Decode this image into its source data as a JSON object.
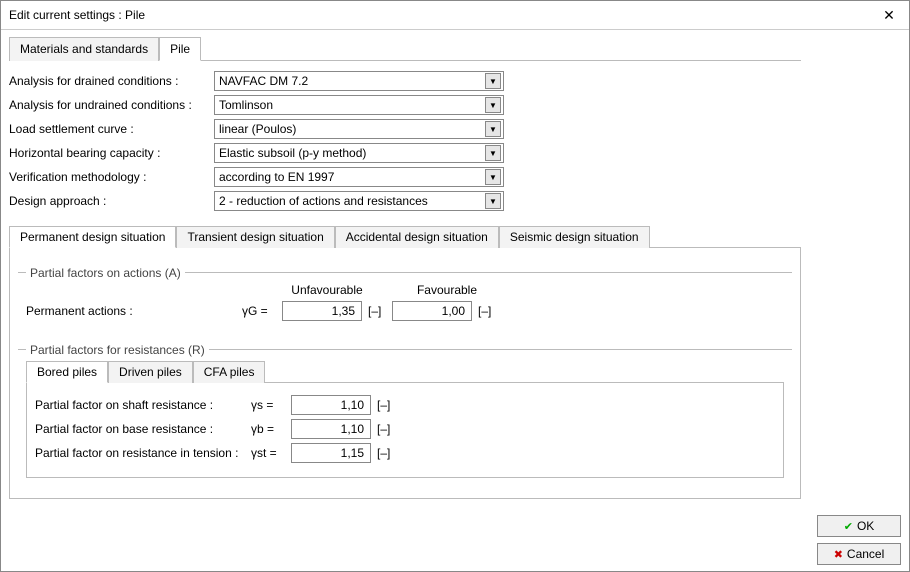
{
  "window": {
    "title": "Edit current settings : Pile"
  },
  "top_tabs": {
    "materials": "Materials and standards",
    "pile": "Pile"
  },
  "settings": {
    "analysis_drained": {
      "label": "Analysis for drained conditions :",
      "value": "NAVFAC DM 7.2"
    },
    "analysis_undrained": {
      "label": "Analysis for undrained conditions :",
      "value": "Tomlinson"
    },
    "load_settlement": {
      "label": "Load settlement curve :",
      "value": "linear (Poulos)"
    },
    "horiz_capacity": {
      "label": "Horizontal bearing capacity :",
      "value": "Elastic subsoil (p-y method)"
    },
    "verification": {
      "label": "Verification methodology :",
      "value": "according to EN 1997"
    },
    "design_approach": {
      "label": "Design approach :",
      "value": "2 - reduction of actions and resistances"
    }
  },
  "situation_tabs": {
    "permanent": "Permanent design situation",
    "transient": "Transient design situation",
    "accidental": "Accidental design situation",
    "seismic": "Seismic design situation"
  },
  "actions_group": {
    "legend": "Partial factors on actions (A)",
    "unfav": "Unfavourable",
    "fav": "Favourable",
    "permanent_label": "Permanent actions :",
    "gamma_g": "γG =",
    "val_unfav": "1,35",
    "val_fav": "1,00",
    "unit": "[–]"
  },
  "resist_group": {
    "legend": "Partial factors for resistances (R)",
    "pile_tabs": {
      "bored": "Bored piles",
      "driven": "Driven piles",
      "cfa": "CFA piles"
    },
    "shaft": {
      "label": "Partial factor on shaft resistance :",
      "sym": "γs =",
      "val": "1,10",
      "unit": "[–]"
    },
    "base": {
      "label": "Partial factor on base resistance :",
      "sym": "γb =",
      "val": "1,10",
      "unit": "[–]"
    },
    "tension": {
      "label": "Partial factor on resistance in tension :",
      "sym": "γst =",
      "val": "1,15",
      "unit": "[–]"
    }
  },
  "buttons": {
    "ok": "OK",
    "cancel": "Cancel"
  }
}
